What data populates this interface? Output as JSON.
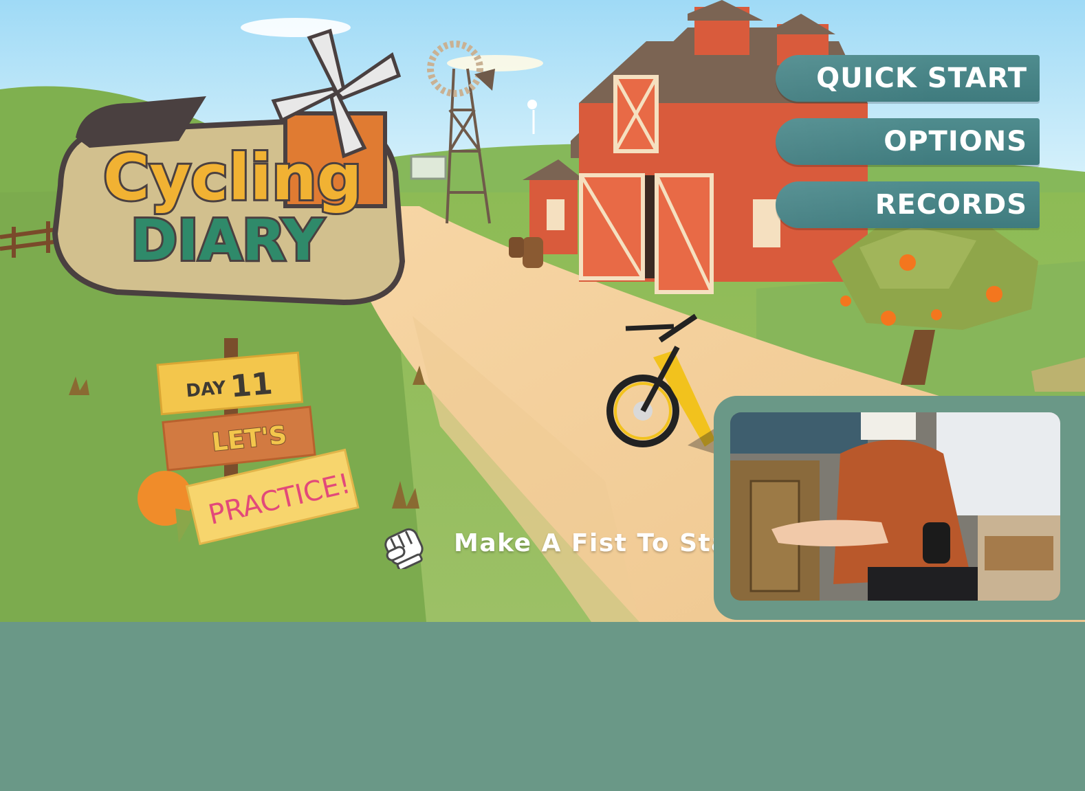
{
  "game": {
    "logo_line1": "Cycling",
    "logo_line2": "DIARY"
  },
  "menu": {
    "items": [
      {
        "label": "QUICK START"
      },
      {
        "label": "OPTIONS"
      },
      {
        "label": "RECORDS"
      }
    ]
  },
  "signpost": {
    "day_label": "DAY",
    "day_number": "11",
    "line2": "LET'S",
    "line3": "PRACTICE!"
  },
  "prompt": {
    "icon": "fist-icon",
    "text": "Make A Fist To Star"
  },
  "colors": {
    "button": "#3f7b7e",
    "panel": "#6a9887",
    "sky": "#a9def7",
    "grass": "#7cab4e",
    "barn": "#d95b3c",
    "sign_pink": "#e2497a"
  }
}
